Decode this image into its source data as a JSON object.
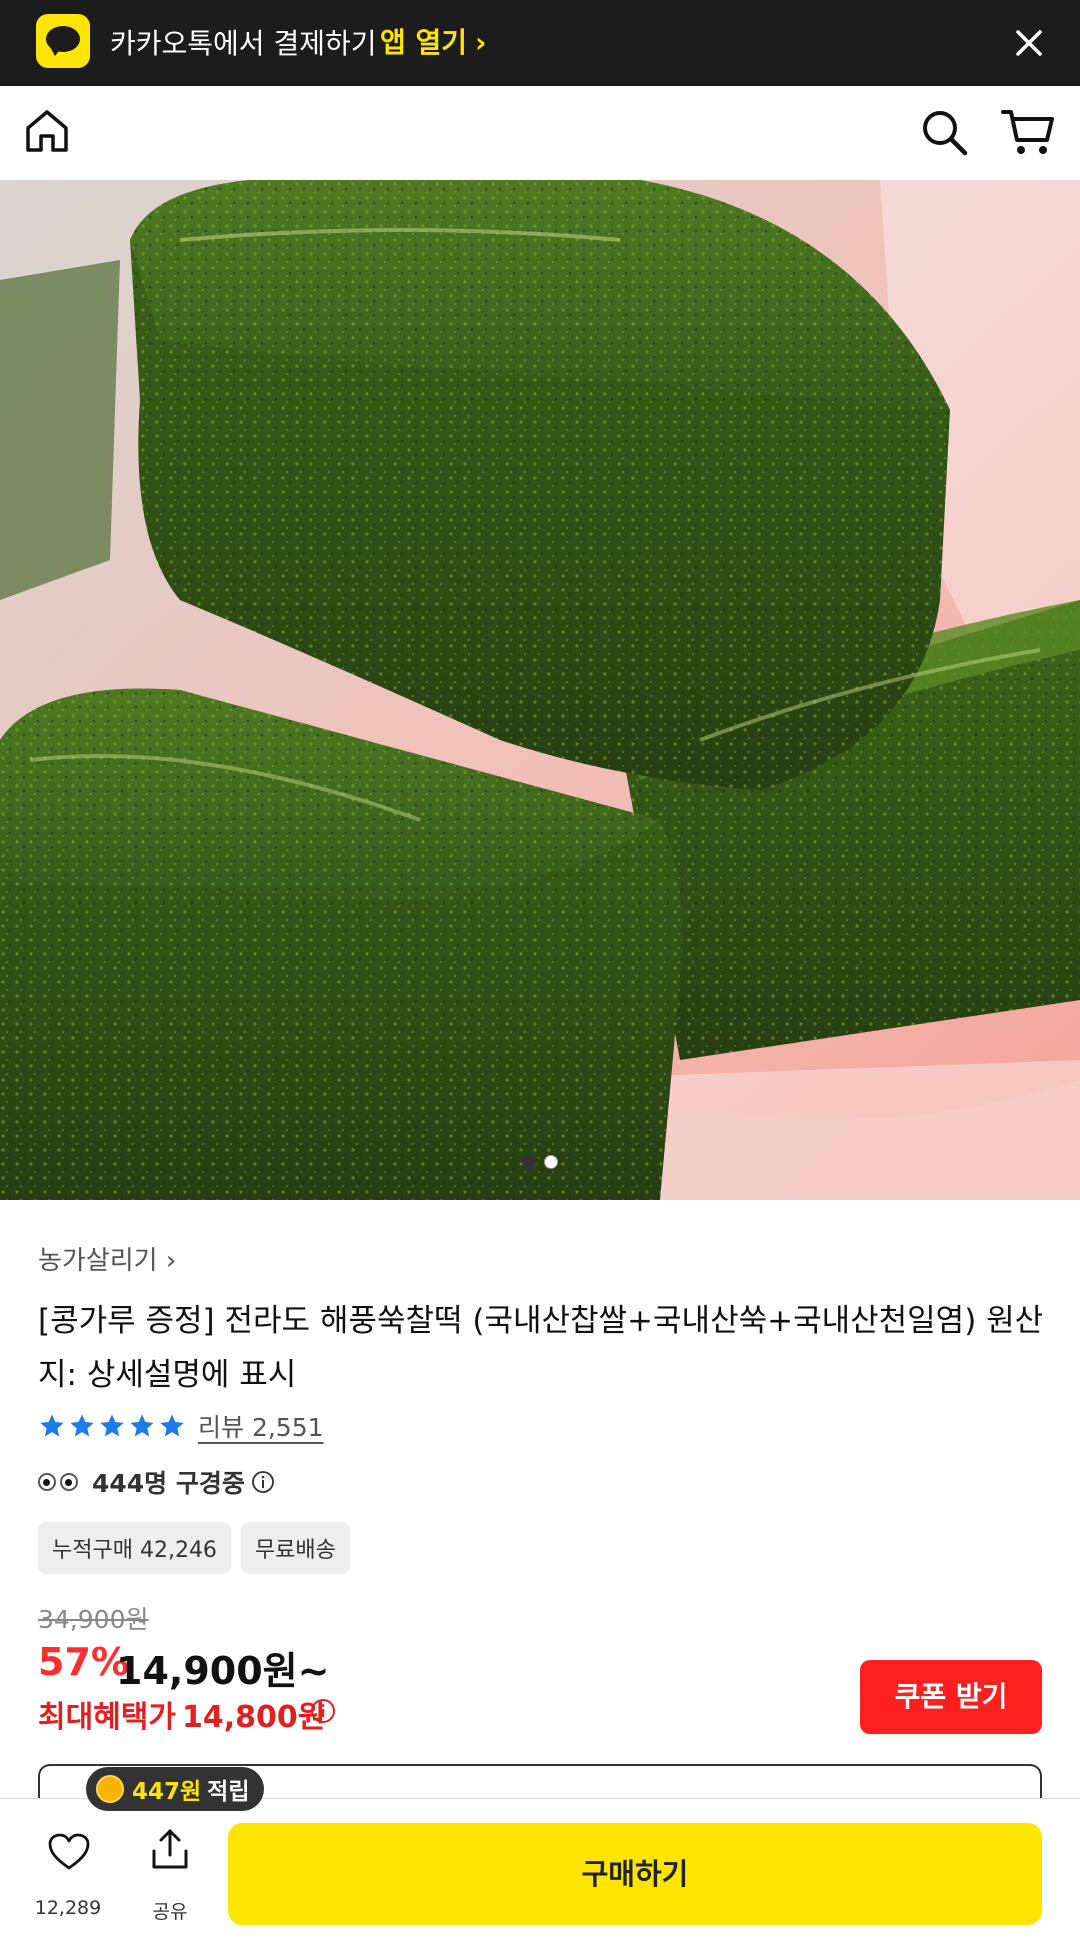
{
  "kakao_banner": {
    "text": "카카오톡에서 결제하기",
    "open_label": "앱 열기",
    "open_chevron": "›"
  },
  "nav": {
    "icons": [
      "home-icon",
      "search-icon",
      "cart-icon"
    ]
  },
  "hero": {
    "image_index": 1,
    "image_count": 2
  },
  "product": {
    "store_name": "농가살리기 ›",
    "title": "[콩가루 증정] 전라도 해풍쑥찰떡 (국내산찹쌀+국내산쑥+국내산천일염) 원산지: 상세설명에 표시",
    "rating": 5,
    "review_label": "리뷰 2,551",
    "viewers_text": "444명 구경중",
    "tags": [
      "누적구매 42,246",
      "무료배송"
    ]
  },
  "price": {
    "original": "34,900원",
    "discount": "57%",
    "sale": "14,900원~",
    "best_label": "최대혜택가",
    "best_price": "14,800원"
  },
  "coupon_button": "쿠폰 받기",
  "points": {
    "amount": "447원",
    "label": "적립"
  },
  "bottom": {
    "like_count": "12,289",
    "share_label": "공유",
    "buy_label": "구매하기"
  },
  "colors": {
    "kakao_yellow": "#fee500",
    "sale_red": "#ff2d2d",
    "coupon_red": "#ff1f1f",
    "star_blue": "#1e7ce8"
  }
}
